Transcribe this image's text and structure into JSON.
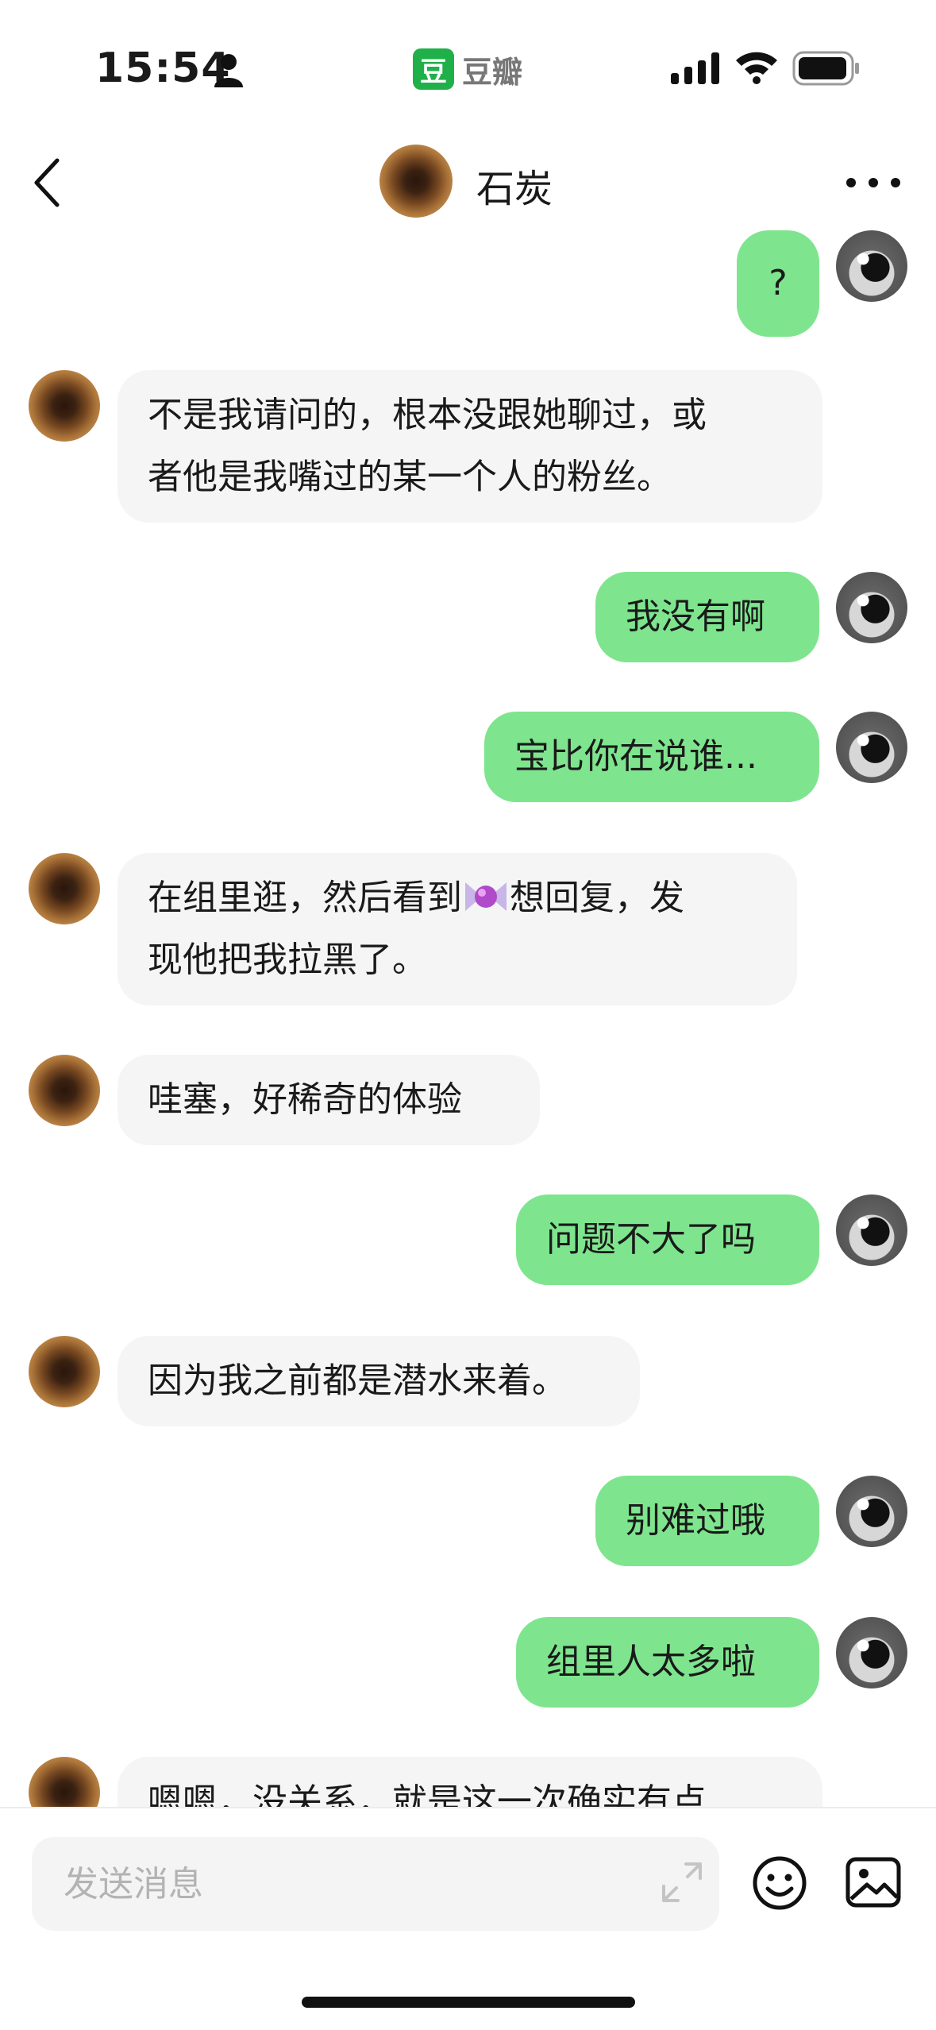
{
  "status_bar": {
    "time": "15:54",
    "app_logo_char": "豆",
    "app_name": "豆瓣",
    "icons": [
      "person-icon",
      "signal-icon",
      "wifi-icon",
      "battery-icon"
    ]
  },
  "header": {
    "title": "石炭",
    "back_icon": "back-icon",
    "more_icon": "more-icon"
  },
  "messages": [
    {
      "sender": "me",
      "text": "?"
    },
    {
      "sender": "them",
      "text": "不是我请问的，根本没跟她聊过，或\n者他是我嘴过的某一个人的粉丝。"
    },
    {
      "sender": "me",
      "text": "我没有啊"
    },
    {
      "sender": "me",
      "text": "宝比你在说谁..."
    },
    {
      "sender": "them",
      "text_before": "在组里逛，然后看到",
      "emoji": "candy-icon",
      "text_after": "想回复，发\n现他把我拉黑了。"
    },
    {
      "sender": "them",
      "text": "哇塞，好稀奇的体验"
    },
    {
      "sender": "me",
      "text": "问题不大了吗"
    },
    {
      "sender": "them",
      "text": "因为我之前都是潜水来着。"
    },
    {
      "sender": "me",
      "text": "别难过哦"
    },
    {
      "sender": "me",
      "text": "组里人太多啦"
    },
    {
      "sender": "them",
      "text": "嗯嗯，没关系，就是这一次确实有点"
    }
  ],
  "input_bar": {
    "placeholder": "发送消息",
    "icons": [
      "expand-icon",
      "emoji-icon",
      "image-icon"
    ]
  },
  "colors": {
    "my_bubble": "#7ee58e",
    "their_bubble": "#f5f5f5",
    "douban_green": "#20b04a"
  }
}
